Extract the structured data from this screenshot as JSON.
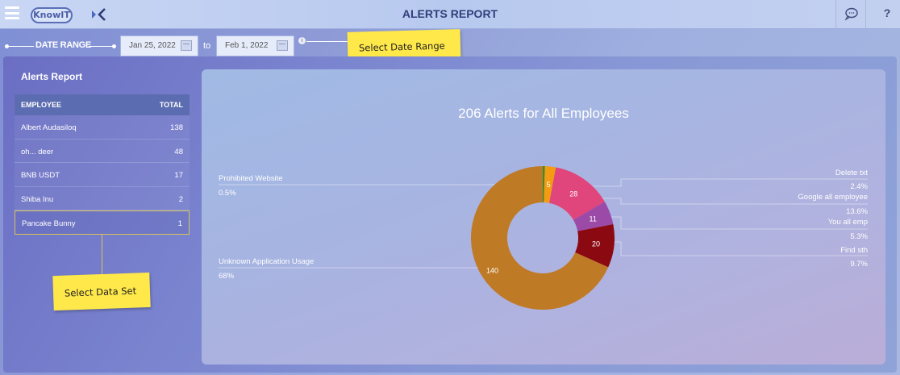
{
  "header": {
    "logo_text": "KnowIT",
    "title": "ALERTS REPORT",
    "help_label": "?",
    "icons": [
      "menu-icon",
      "back-chevron-icon",
      "chat-bubble-icon",
      "help-icon"
    ]
  },
  "date_range": {
    "label": "DATE RANGE",
    "start": "Jan 25, 2022",
    "separator": "to",
    "end": "Feb 1, 2022",
    "info": "i"
  },
  "callouts": {
    "date": "Select Date Range",
    "dataset": "Select Data Set"
  },
  "left_panel": {
    "title": "Alerts Report",
    "columns": [
      "EMPLOYEE",
      "TOTAL"
    ],
    "rows": [
      {
        "name": "Albert Audasiloq",
        "total": "138"
      },
      {
        "name": "oh... deer",
        "total": "48"
      },
      {
        "name": "BNB USDT",
        "total": "17"
      },
      {
        "name": "Shiba Inu",
        "total": "2"
      },
      {
        "name": "Pancake Bunny",
        "total": "1"
      }
    ]
  },
  "chart_data": {
    "type": "pie",
    "title": "206 Alerts for All Employees",
    "slices": [
      {
        "name": "Prohibited Website",
        "value": 1,
        "percent": "0.5%",
        "color": "#3a8c2f"
      },
      {
        "name": "Delete txt",
        "value": 5,
        "percent": "2.4%",
        "color": "#f39c12"
      },
      {
        "name": "Google all employee",
        "value": 28,
        "percent": "13.6%",
        "color": "#e0457b"
      },
      {
        "name": "You all emp",
        "value": 11,
        "percent": "5.3%",
        "color": "#9c4aa8"
      },
      {
        "name": "Find sth",
        "value": 20,
        "percent": "9.7%",
        "color": "#8b0a12"
      },
      {
        "name": "Unknown Application Usage",
        "value": 140,
        "percent": "68%",
        "color": "#bf7a26"
      }
    ]
  }
}
